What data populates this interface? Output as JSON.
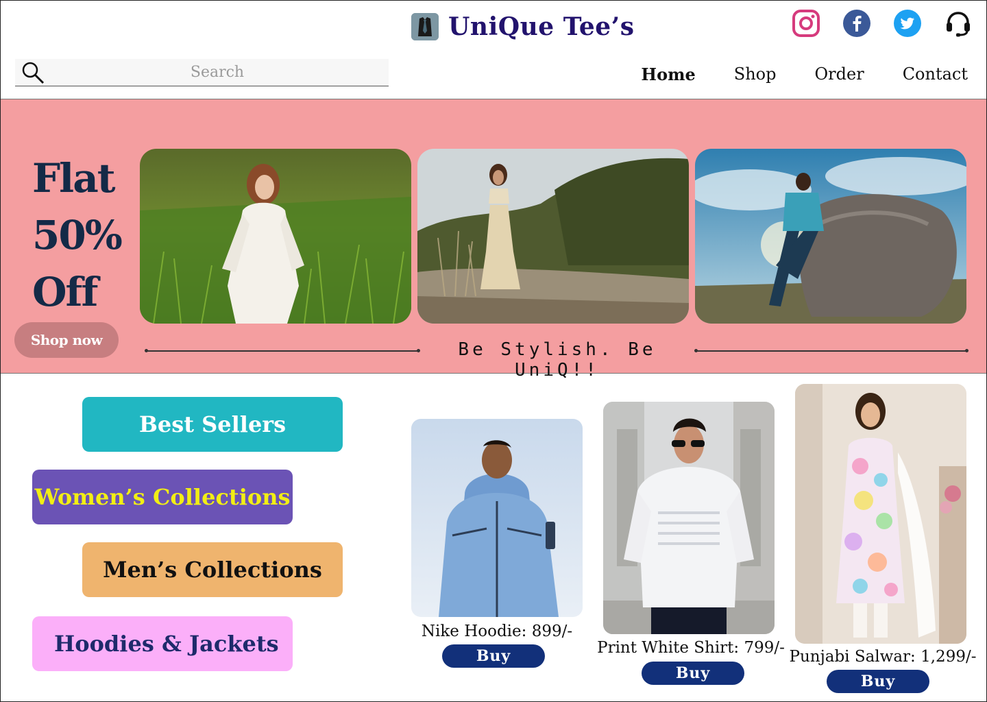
{
  "brand": {
    "name": "UniQue Tee’s",
    "logo_icon": "shirt-tie-icon"
  },
  "socials": [
    {
      "name": "instagram-icon",
      "color": "#d63b7d"
    },
    {
      "name": "facebook-icon",
      "color": "#3b5998"
    },
    {
      "name": "twitter-icon",
      "color": "#1da1f2"
    },
    {
      "name": "headset-support-icon",
      "color": "#111111"
    }
  ],
  "search": {
    "placeholder": "Search",
    "value": ""
  },
  "nav": {
    "items": [
      "Home",
      "Shop",
      "Order",
      "Contact"
    ],
    "active": "Home"
  },
  "hero": {
    "promo_lines": [
      "Flat",
      "50%",
      "Off"
    ],
    "cta_label": "Shop now",
    "tagline": "Be Stylish. Be UniQ!!",
    "background": "#f49ea0"
  },
  "categories": [
    {
      "label": "Best Sellers",
      "color": "#21b7c2"
    },
    {
      "label": "Women’s Collections",
      "color": "#6b53b5"
    },
    {
      "label": "Men’s Collections",
      "color": "#efb46e"
    },
    {
      "label": "Hoodies & Jackets",
      "color": "#fbaff9"
    }
  ],
  "products": [
    {
      "label": "Nike Hoodie: 899/-",
      "buy_label": "Buy"
    },
    {
      "label": "Print White Shirt: 799/-",
      "buy_label": "Buy"
    },
    {
      "label": "Punjabi Salwar: 1,299/-",
      "buy_label": "Buy"
    }
  ]
}
